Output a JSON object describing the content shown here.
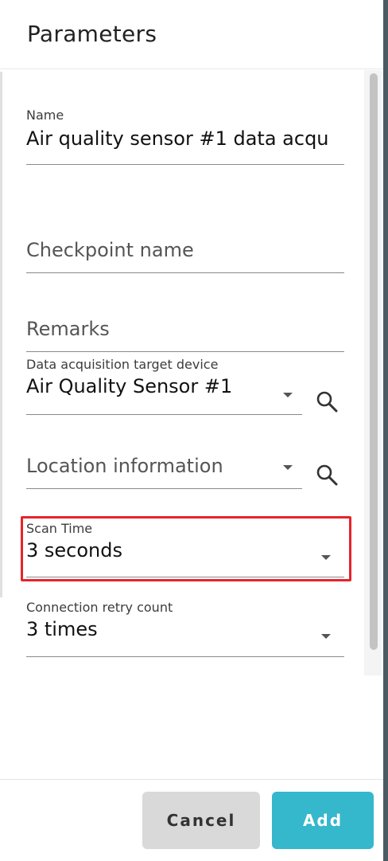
{
  "dialog": {
    "title": "Parameters"
  },
  "fields": {
    "name": {
      "label": "Name",
      "value": "Air quality sensor #1 data acqu"
    },
    "checkpoint": {
      "placeholder": "Checkpoint name"
    },
    "remarks": {
      "placeholder": "Remarks"
    },
    "target_device": {
      "label": "Data acquisition target device",
      "value": "Air Quality Sensor #1"
    },
    "location": {
      "placeholder": "Location information"
    },
    "scan_time": {
      "label": "Scan Time",
      "value": "3 seconds"
    },
    "retry_count": {
      "label": "Connection retry count",
      "value": "3 times"
    }
  },
  "footer": {
    "cancel_label": "Cancel",
    "add_label": "Add"
  },
  "colors": {
    "accent": "#35b7cc",
    "highlight": "#e6242a"
  },
  "icons": {
    "search": "search-icon",
    "dropdown": "chevron-down-icon"
  }
}
